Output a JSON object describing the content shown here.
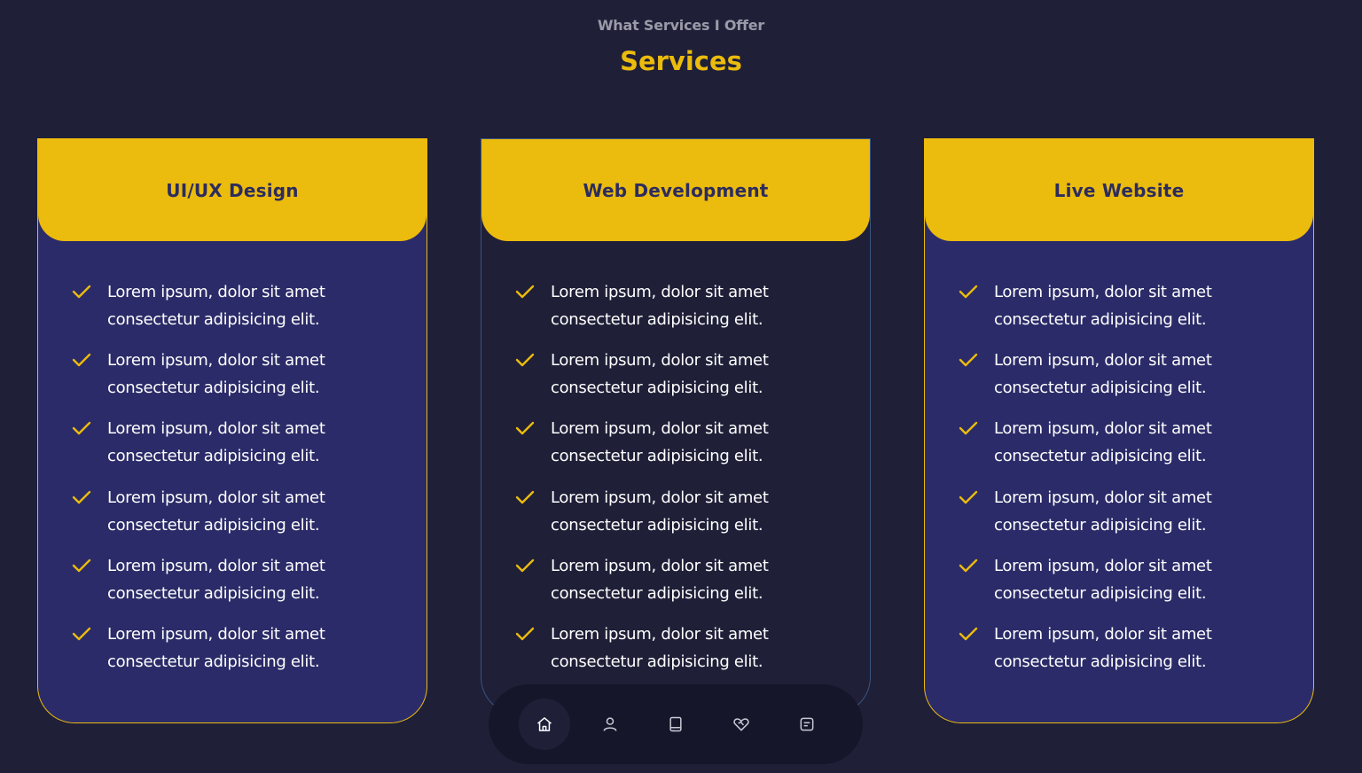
{
  "header": {
    "subtitle": "What Services I Offer",
    "title": "Services"
  },
  "colors": {
    "accent": "#ebbb0d",
    "background": "#1f1f38",
    "card_fill": "#2b2b69",
    "text": "#ffffff"
  },
  "cards": [
    {
      "title": "UI/UX Design",
      "items": [
        "Lorem ipsum, dolor sit amet consectetur adipisicing elit.",
        "Lorem ipsum, dolor sit amet consectetur adipisicing elit.",
        "Lorem ipsum, dolor sit amet consectetur adipisicing elit.",
        "Lorem ipsum, dolor sit amet consectetur adipisicing elit.",
        "Lorem ipsum, dolor sit amet consectetur adipisicing elit.",
        "Lorem ipsum, dolor sit amet consectetur adipisicing elit."
      ]
    },
    {
      "title": "Web Development",
      "items": [
        "Lorem ipsum, dolor sit amet consectetur adipisicing elit.",
        "Lorem ipsum, dolor sit amet consectetur adipisicing elit.",
        "Lorem ipsum, dolor sit amet consectetur adipisicing elit.",
        "Lorem ipsum, dolor sit amet consectetur adipisicing elit.",
        "Lorem ipsum, dolor sit amet consectetur adipisicing elit.",
        "Lorem ipsum, dolor sit amet consectetur adipisicing elit."
      ]
    },
    {
      "title": "Live Website",
      "items": [
        "Lorem ipsum, dolor sit amet consectetur adipisicing elit.",
        "Lorem ipsum, dolor sit amet consectetur adipisicing elit.",
        "Lorem ipsum, dolor sit amet consectetur adipisicing elit.",
        "Lorem ipsum, dolor sit amet consectetur adipisicing elit.",
        "Lorem ipsum, dolor sit amet consectetur adipisicing elit.",
        "Lorem ipsum, dolor sit amet consectetur adipisicing elit."
      ]
    }
  ],
  "dock": {
    "items": [
      {
        "icon": "home-icon",
        "active": true
      },
      {
        "icon": "user-icon",
        "active": false
      },
      {
        "icon": "book-icon",
        "active": false
      },
      {
        "icon": "handshake-icon",
        "active": false
      },
      {
        "icon": "message-icon",
        "active": false
      }
    ]
  }
}
